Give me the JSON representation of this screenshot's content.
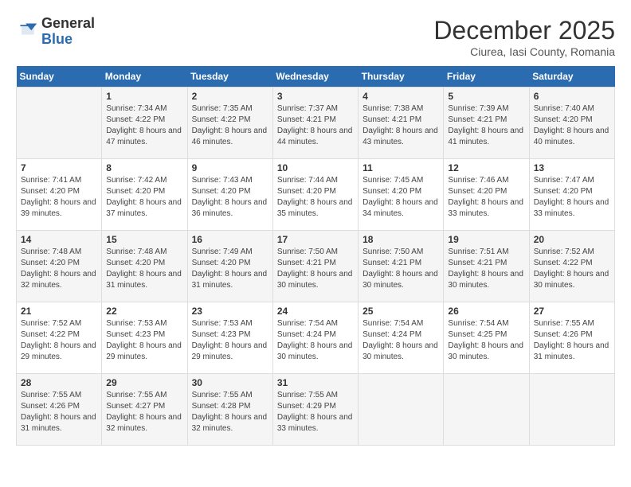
{
  "logo": {
    "general": "General",
    "blue": "Blue"
  },
  "title": "December 2025",
  "location": "Ciurea, Iasi County, Romania",
  "days_of_week": [
    "Sunday",
    "Monday",
    "Tuesday",
    "Wednesday",
    "Thursday",
    "Friday",
    "Saturday"
  ],
  "weeks": [
    [
      {
        "day": "",
        "sunrise": "",
        "sunset": "",
        "daylight": ""
      },
      {
        "day": "1",
        "sunrise": "Sunrise: 7:34 AM",
        "sunset": "Sunset: 4:22 PM",
        "daylight": "Daylight: 8 hours and 47 minutes."
      },
      {
        "day": "2",
        "sunrise": "Sunrise: 7:35 AM",
        "sunset": "Sunset: 4:22 PM",
        "daylight": "Daylight: 8 hours and 46 minutes."
      },
      {
        "day": "3",
        "sunrise": "Sunrise: 7:37 AM",
        "sunset": "Sunset: 4:21 PM",
        "daylight": "Daylight: 8 hours and 44 minutes."
      },
      {
        "day": "4",
        "sunrise": "Sunrise: 7:38 AM",
        "sunset": "Sunset: 4:21 PM",
        "daylight": "Daylight: 8 hours and 43 minutes."
      },
      {
        "day": "5",
        "sunrise": "Sunrise: 7:39 AM",
        "sunset": "Sunset: 4:21 PM",
        "daylight": "Daylight: 8 hours and 41 minutes."
      },
      {
        "day": "6",
        "sunrise": "Sunrise: 7:40 AM",
        "sunset": "Sunset: 4:20 PM",
        "daylight": "Daylight: 8 hours and 40 minutes."
      }
    ],
    [
      {
        "day": "7",
        "sunrise": "Sunrise: 7:41 AM",
        "sunset": "Sunset: 4:20 PM",
        "daylight": "Daylight: 8 hours and 39 minutes."
      },
      {
        "day": "8",
        "sunrise": "Sunrise: 7:42 AM",
        "sunset": "Sunset: 4:20 PM",
        "daylight": "Daylight: 8 hours and 37 minutes."
      },
      {
        "day": "9",
        "sunrise": "Sunrise: 7:43 AM",
        "sunset": "Sunset: 4:20 PM",
        "daylight": "Daylight: 8 hours and 36 minutes."
      },
      {
        "day": "10",
        "sunrise": "Sunrise: 7:44 AM",
        "sunset": "Sunset: 4:20 PM",
        "daylight": "Daylight: 8 hours and 35 minutes."
      },
      {
        "day": "11",
        "sunrise": "Sunrise: 7:45 AM",
        "sunset": "Sunset: 4:20 PM",
        "daylight": "Daylight: 8 hours and 34 minutes."
      },
      {
        "day": "12",
        "sunrise": "Sunrise: 7:46 AM",
        "sunset": "Sunset: 4:20 PM",
        "daylight": "Daylight: 8 hours and 33 minutes."
      },
      {
        "day": "13",
        "sunrise": "Sunrise: 7:47 AM",
        "sunset": "Sunset: 4:20 PM",
        "daylight": "Daylight: 8 hours and 33 minutes."
      }
    ],
    [
      {
        "day": "14",
        "sunrise": "Sunrise: 7:48 AM",
        "sunset": "Sunset: 4:20 PM",
        "daylight": "Daylight: 8 hours and 32 minutes."
      },
      {
        "day": "15",
        "sunrise": "Sunrise: 7:48 AM",
        "sunset": "Sunset: 4:20 PM",
        "daylight": "Daylight: 8 hours and 31 minutes."
      },
      {
        "day": "16",
        "sunrise": "Sunrise: 7:49 AM",
        "sunset": "Sunset: 4:20 PM",
        "daylight": "Daylight: 8 hours and 31 minutes."
      },
      {
        "day": "17",
        "sunrise": "Sunrise: 7:50 AM",
        "sunset": "Sunset: 4:21 PM",
        "daylight": "Daylight: 8 hours and 30 minutes."
      },
      {
        "day": "18",
        "sunrise": "Sunrise: 7:50 AM",
        "sunset": "Sunset: 4:21 PM",
        "daylight": "Daylight: 8 hours and 30 minutes."
      },
      {
        "day": "19",
        "sunrise": "Sunrise: 7:51 AM",
        "sunset": "Sunset: 4:21 PM",
        "daylight": "Daylight: 8 hours and 30 minutes."
      },
      {
        "day": "20",
        "sunrise": "Sunrise: 7:52 AM",
        "sunset": "Sunset: 4:22 PM",
        "daylight": "Daylight: 8 hours and 30 minutes."
      }
    ],
    [
      {
        "day": "21",
        "sunrise": "Sunrise: 7:52 AM",
        "sunset": "Sunset: 4:22 PM",
        "daylight": "Daylight: 8 hours and 29 minutes."
      },
      {
        "day": "22",
        "sunrise": "Sunrise: 7:53 AM",
        "sunset": "Sunset: 4:23 PM",
        "daylight": "Daylight: 8 hours and 29 minutes."
      },
      {
        "day": "23",
        "sunrise": "Sunrise: 7:53 AM",
        "sunset": "Sunset: 4:23 PM",
        "daylight": "Daylight: 8 hours and 29 minutes."
      },
      {
        "day": "24",
        "sunrise": "Sunrise: 7:54 AM",
        "sunset": "Sunset: 4:24 PM",
        "daylight": "Daylight: 8 hours and 30 minutes."
      },
      {
        "day": "25",
        "sunrise": "Sunrise: 7:54 AM",
        "sunset": "Sunset: 4:24 PM",
        "daylight": "Daylight: 8 hours and 30 minutes."
      },
      {
        "day": "26",
        "sunrise": "Sunrise: 7:54 AM",
        "sunset": "Sunset: 4:25 PM",
        "daylight": "Daylight: 8 hours and 30 minutes."
      },
      {
        "day": "27",
        "sunrise": "Sunrise: 7:55 AM",
        "sunset": "Sunset: 4:26 PM",
        "daylight": "Daylight: 8 hours and 31 minutes."
      }
    ],
    [
      {
        "day": "28",
        "sunrise": "Sunrise: 7:55 AM",
        "sunset": "Sunset: 4:26 PM",
        "daylight": "Daylight: 8 hours and 31 minutes."
      },
      {
        "day": "29",
        "sunrise": "Sunrise: 7:55 AM",
        "sunset": "Sunset: 4:27 PM",
        "daylight": "Daylight: 8 hours and 32 minutes."
      },
      {
        "day": "30",
        "sunrise": "Sunrise: 7:55 AM",
        "sunset": "Sunset: 4:28 PM",
        "daylight": "Daylight: 8 hours and 32 minutes."
      },
      {
        "day": "31",
        "sunrise": "Sunrise: 7:55 AM",
        "sunset": "Sunset: 4:29 PM",
        "daylight": "Daylight: 8 hours and 33 minutes."
      },
      {
        "day": "",
        "sunrise": "",
        "sunset": "",
        "daylight": ""
      },
      {
        "day": "",
        "sunrise": "",
        "sunset": "",
        "daylight": ""
      },
      {
        "day": "",
        "sunrise": "",
        "sunset": "",
        "daylight": ""
      }
    ]
  ]
}
